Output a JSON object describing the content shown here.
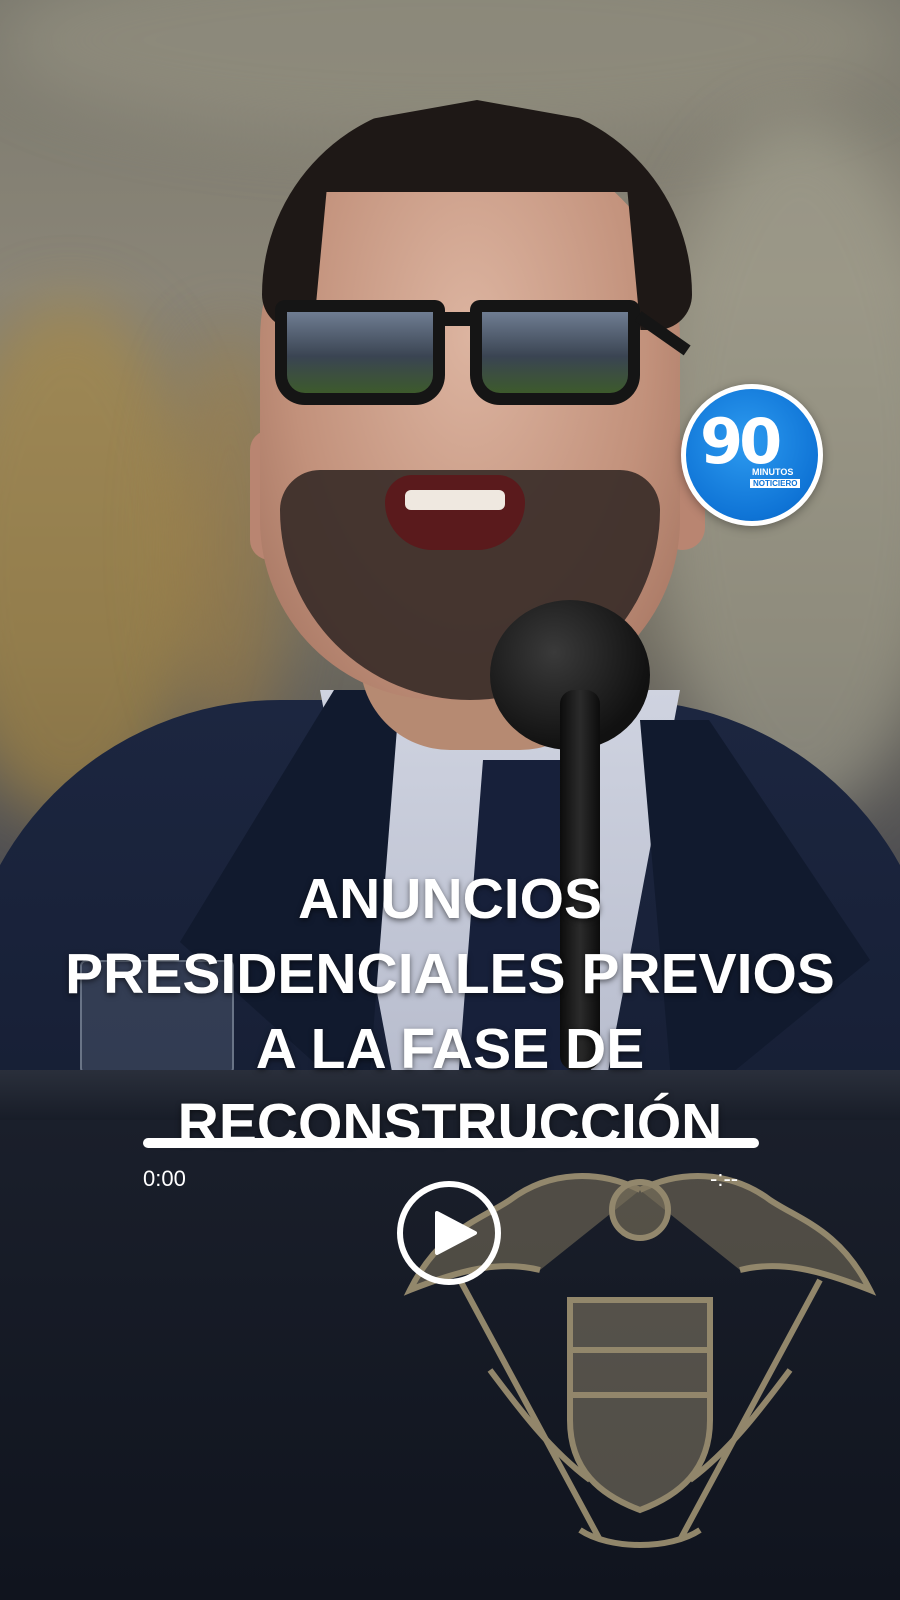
{
  "logo": {
    "number": "90",
    "line1": "MINUTOS",
    "line2": "NOTICIERO",
    "color": "#0f74d6"
  },
  "headline": {
    "lines": [
      "ANUNCIOS",
      "PRESIDENCIALES PREVIOS",
      "A LA FASE DE",
      "RECONSTRUCCIÓN"
    ]
  },
  "player": {
    "current_time": "0:00",
    "total_time": "-:--",
    "progress": 0,
    "play_icon": "play-icon"
  }
}
